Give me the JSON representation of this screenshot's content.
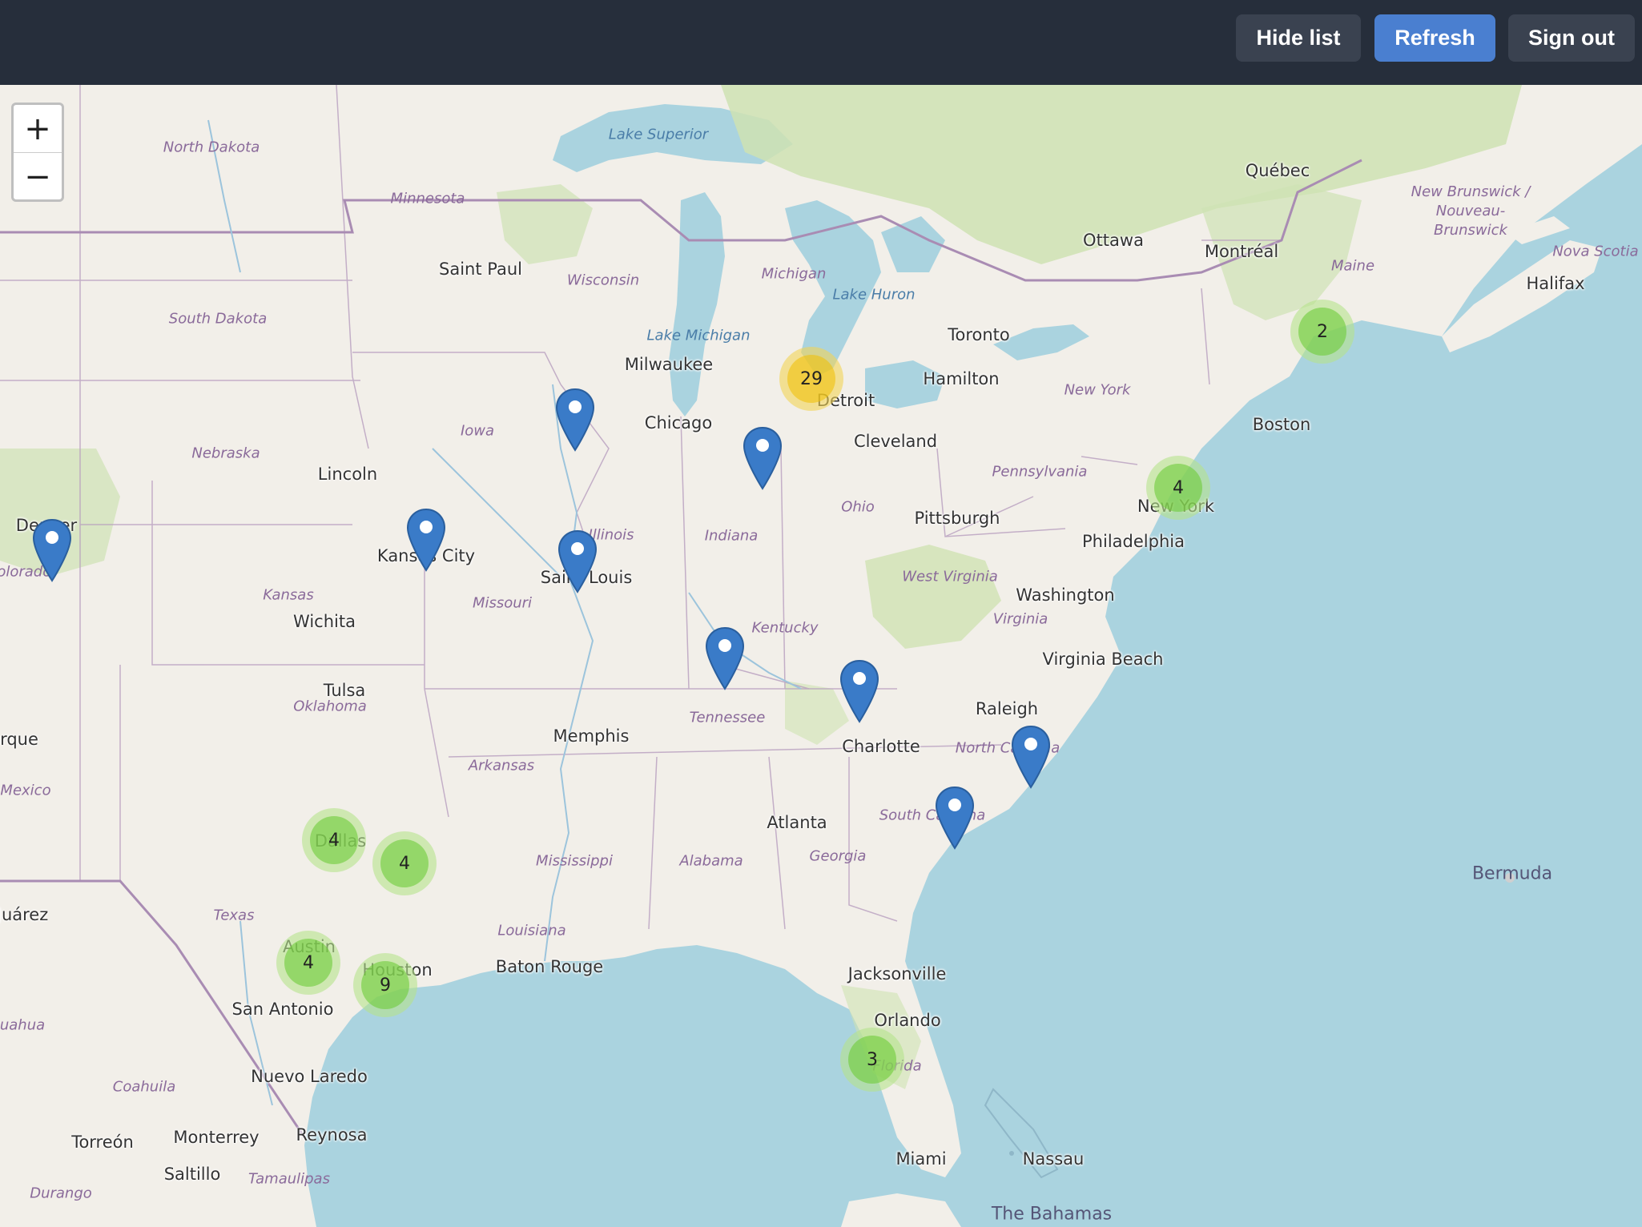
{
  "toolbar": {
    "hide_list_label": "Hide list",
    "refresh_label": "Refresh",
    "sign_out_label": "Sign out"
  },
  "map": {
    "zoom_in_label": "+",
    "zoom_out_label": "−",
    "cities": {
      "quebec": "Québec",
      "ottawa": "Ottawa",
      "montreal": "Montréal",
      "halifax": "Halifax",
      "saint_paul": "Saint Paul",
      "toronto": "Toronto",
      "hamilton": "Hamilton",
      "milwaukee": "Milwaukee",
      "detroit": "Detroit",
      "chicago": "Chicago",
      "cleveland": "Cleveland",
      "boston": "Boston",
      "lincoln": "Lincoln",
      "denver": "Denver",
      "kansas_city": "Kansas City",
      "saint_louis": "Saint Louis",
      "pittsburgh": "Pittsburgh",
      "new_york": "New York",
      "philadelphia": "Philadelphia",
      "washington": "Washington",
      "wichita": "Wichita",
      "virginia_beach": "Virginia Beach",
      "tulsa": "Tulsa",
      "albuquerque": "rque",
      "raleigh": "Raleigh",
      "memphis": "Memphis",
      "charlotte": "Charlotte",
      "atlanta": "Atlanta",
      "dallas": "Dallas",
      "juarez": "Juárez",
      "austin": "Austin",
      "houston": "Houston",
      "baton_rouge": "Baton Rouge",
      "jacksonville": "Jacksonville",
      "san_antonio": "San Antonio",
      "orlando": "Orlando",
      "nuevo_laredo": "Nuevo Laredo",
      "torreon": "Torreón",
      "monterrey": "Monterrey",
      "reynosa": "Reynosa",
      "saltillo": "Saltillo",
      "miami": "Miami",
      "nassau": "Nassau"
    },
    "regions": {
      "north_dakota": "North Dakota",
      "minnesota": "Minnesota",
      "south_dakota": "South Dakota",
      "wisconsin": "Wisconsin",
      "michigan": "Michigan",
      "new_brunswick": "New Brunswick /\nNouveau-\nBrunswick",
      "nova_scotia": "Nova Scotia",
      "maine": "Maine",
      "iowa": "Iowa",
      "nebraska": "Nebraska",
      "new_york_state": "New York",
      "pennsylvania": "Pennsylvania",
      "ohio": "Ohio",
      "illinois": "Illinois",
      "indiana": "Indiana",
      "colorado": "Colorado",
      "kansas": "Kansas",
      "missouri": "Missouri",
      "west_virginia": "West Virginia",
      "virginia": "Virginia",
      "kentucky": "Kentucky",
      "oklahoma": "Oklahoma",
      "tennessee": "Tennessee",
      "north_carolina": "North Carolina",
      "arkansas": "Arkansas",
      "mexico": "Mexico",
      "south_carolina": "South Carolina",
      "mississippi": "Mississippi",
      "alabama": "Alabama",
      "georgia": "Georgia",
      "texas": "Texas",
      "louisiana": "Louisiana",
      "florida": "Florida",
      "chihuahua": "uahua",
      "coahuila": "Coahuila",
      "durango": "Durango",
      "tamaulipas": "Tamaulipas"
    },
    "water": {
      "lake_superior": "Lake Superior",
      "lake_michigan": "Lake Michigan",
      "lake_huron": "Lake Huron"
    },
    "places": {
      "bermuda": "Bermuda",
      "the_bahamas": "The Bahamas"
    },
    "clusters": [
      {
        "id": "cluster-maine",
        "count": "2",
        "color": "green"
      },
      {
        "id": "cluster-detroit",
        "count": "29",
        "color": "yellow"
      },
      {
        "id": "cluster-new-york",
        "count": "4",
        "color": "green"
      },
      {
        "id": "cluster-dallas",
        "count": "4",
        "color": "green"
      },
      {
        "id": "cluster-dallas-east",
        "count": "4",
        "color": "green"
      },
      {
        "id": "cluster-austin",
        "count": "4",
        "color": "green"
      },
      {
        "id": "cluster-houston",
        "count": "9",
        "color": "green"
      },
      {
        "id": "cluster-florida",
        "count": "3",
        "color": "green"
      }
    ],
    "colors": {
      "pin": "#3a7bc8",
      "topbar": "#262e3b",
      "refresh": "#4a7fd0",
      "land": "#f2efe9",
      "water": "#aad3df",
      "forest": "#cfe2b3"
    }
  }
}
